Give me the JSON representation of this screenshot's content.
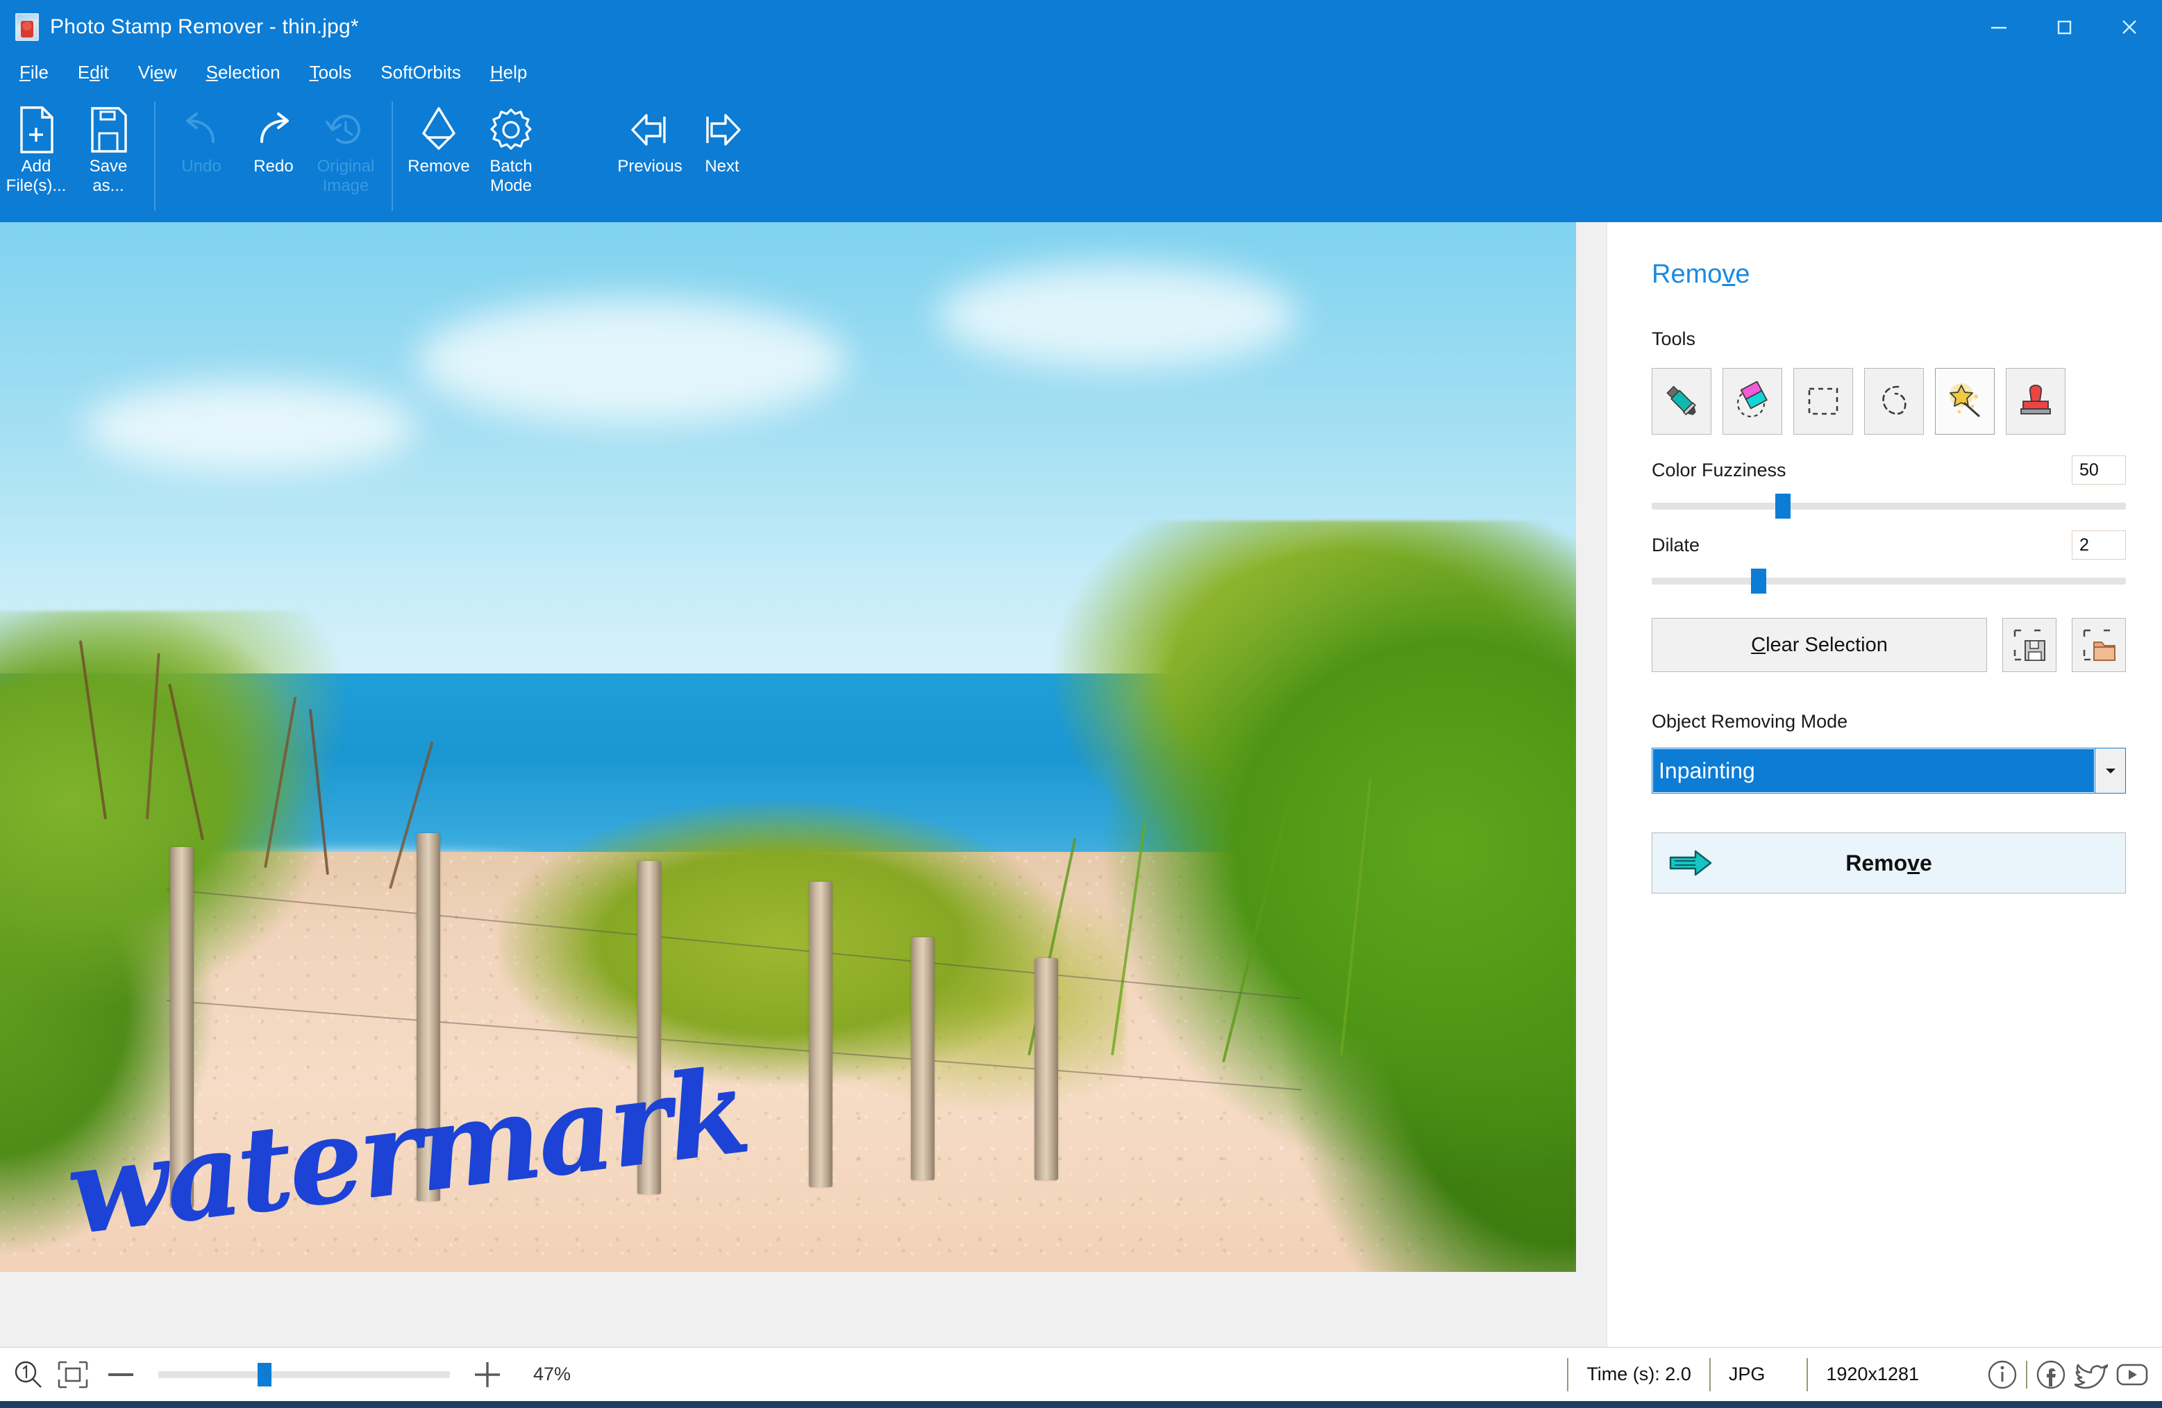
{
  "window": {
    "title": "Photo Stamp Remover - thin.jpg*",
    "app_icon": "photo-stamp-icon",
    "controls": {
      "minimize": "minimize-icon",
      "maximize": "maximize-icon",
      "close": "close-icon"
    },
    "accent_color": "#0c7cd5"
  },
  "menubar": {
    "items": [
      {
        "label": "File",
        "accel": "F"
      },
      {
        "label": "Edit",
        "accel": "E"
      },
      {
        "label": "View",
        "accel": "V"
      },
      {
        "label": "Selection",
        "accel": "S"
      },
      {
        "label": "SoftOrbits",
        "accel": ""
      },
      {
        "label": "Help",
        "accel": "H"
      }
    ]
  },
  "toolbar": {
    "group1": [
      {
        "label": "Add\nFile(s)...",
        "line1": "Add",
        "line2": "File(s)...",
        "icon": "add-file-icon",
        "disabled": false
      },
      {
        "label": "Save as...",
        "line1": "Save",
        "line2": "as...",
        "icon": "save-as-icon",
        "disabled": false
      }
    ],
    "group2": [
      {
        "line1": "Undo",
        "line2": "",
        "icon": "undo-icon",
        "disabled": true
      },
      {
        "line1": "Redo",
        "line2": "",
        "icon": "redo-icon",
        "disabled": false
      },
      {
        "line1": "Original",
        "line2": "Image",
        "icon": "original-image-icon",
        "disabled": true
      }
    ],
    "group3": [
      {
        "line1": "Remove",
        "line2": "",
        "icon": "eraser-icon",
        "disabled": false
      },
      {
        "line1": "Batch",
        "line2": "Mode",
        "icon": "gear-icon",
        "disabled": false
      }
    ],
    "group4": [
      {
        "line1": "Previous",
        "line2": "",
        "icon": "arrow-left-icon",
        "disabled": false
      },
      {
        "line1": "Next",
        "line2": "",
        "icon": "arrow-right-icon",
        "disabled": false
      }
    ]
  },
  "canvas": {
    "watermark_text": "watermark",
    "watermark_color": "#1c43d6",
    "image_description": "beach dune path with wooden fence posts, sea and sky"
  },
  "panel": {
    "title": "Remove",
    "title_accel": "v",
    "tools_label": "Tools",
    "tools": [
      {
        "name": "marker-pen-icon",
        "selected": false
      },
      {
        "name": "eraser-icon",
        "selected": false
      },
      {
        "name": "rectangle-select-icon",
        "selected": false
      },
      {
        "name": "lasso-select-icon",
        "selected": false
      },
      {
        "name": "magic-wand-icon",
        "selected": true
      },
      {
        "name": "stamp-icon",
        "selected": false
      }
    ],
    "color_fuzziness": {
      "label": "Color Fuzziness",
      "value": "50",
      "percent": 26
    },
    "dilate": {
      "label": "Dilate",
      "value": "2",
      "percent": 21
    },
    "clear_selection": {
      "label": "Clear Selection",
      "accel": "C"
    },
    "save_selection_icon": "save-selection-icon",
    "load_selection_icon": "load-selection-icon",
    "mode_label": "Object Removing Mode",
    "mode_value": "Inpainting",
    "mode_arrow": "chevron-down-icon",
    "remove_button": {
      "label": "Remove",
      "accel": "v",
      "icon": "arrow-right-teal-icon"
    }
  },
  "statusbar": {
    "zoom_icon": "zoom-1to1-icon",
    "fit_icon": "fit-to-window-icon",
    "minus": "minus-icon",
    "plus": "plus-icon",
    "zoom_percent": "47%",
    "zoom_slider_percent": 34,
    "time": "Time (s): 2.0",
    "format": "JPG",
    "dimensions": "1920x1281",
    "social": [
      {
        "name": "info-icon"
      },
      {
        "name": "facebook-icon"
      },
      {
        "name": "twitter-icon"
      },
      {
        "name": "youtube-icon"
      }
    ]
  }
}
